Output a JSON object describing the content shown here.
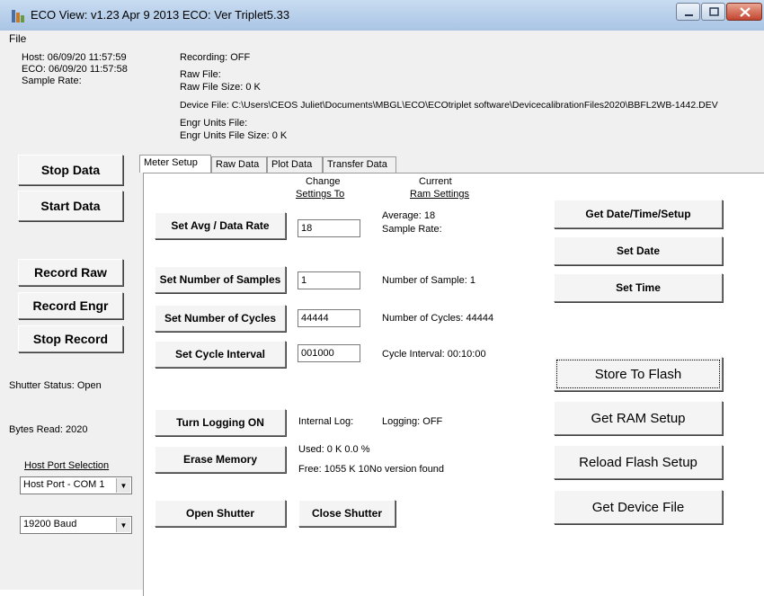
{
  "window": {
    "title": "ECO View:  v1.23 Apr  9 2013 ECO: Ver Triplet5.33"
  },
  "menu": {
    "file": "File"
  },
  "status": {
    "host": "Host:  06/09/20 11:57:59",
    "eco": "ECO:  06/09/20 11:57:58",
    "sample_rate": "Sample Rate:",
    "recording": "Recording:  OFF",
    "raw_file": "Raw File:",
    "raw_file_size": "Raw File Size:  0 K",
    "device_file": "Device File:  C:\\Users\\CEOS Juliet\\Documents\\MBGL\\ECO\\ECOtriplet software\\DevicecalibrationFiles2020\\BBFL2WB-1442.DEV",
    "engr_units_file": "Engr Units File:",
    "engr_units_file_size": "Engr Units File Size:  0 K"
  },
  "left": {
    "stop_data": "Stop Data",
    "start_data": "Start Data",
    "record_raw": "Record  Raw",
    "record_engr": "Record Engr",
    "stop_record": "Stop Record",
    "shutter_status": "Shutter Status: Open",
    "bytes_read": "Bytes Read: 2020",
    "host_port_selection": "Host Port Selection",
    "port_value": "Host Port - COM 1",
    "baud_value": "19200 Baud"
  },
  "tabs": [
    "Meter Setup",
    "Raw Data",
    "Plot Data",
    "Transfer Data"
  ],
  "meter": {
    "col_change_1": "Change",
    "col_change_2": "Settings To",
    "col_current_1": "Current",
    "col_current_2": "Ram Settings",
    "set_avg_btn": "Set Avg / Data Rate",
    "avg_value": "18",
    "avg_current": "Average: 18",
    "sample_rate_current": "Sample Rate:",
    "set_samples_btn": "Set Number of Samples",
    "samples_value": "1",
    "samples_current": "Number of Sample: 1",
    "set_cycles_btn": "Set Number of Cycles",
    "cycles_value": "44444",
    "cycles_current": "Number of Cycles: 44444",
    "set_interval_btn": "Set Cycle Interval",
    "interval_value": "001000",
    "interval_current": "Cycle Interval: 00:10:00",
    "turn_logging_btn": "Turn Logging ON",
    "internal_log": "Internal Log:",
    "logging": "Logging:  OFF",
    "erase_btn": "Erase Memory",
    "used": "Used:  0 K   0.0 %",
    "free": "Free:  1055 K  10No version found",
    "open_shutter_btn": "Open Shutter",
    "close_shutter_btn": "Close Shutter",
    "get_datetime_btn": "Get Date/Time/Setup",
    "set_date_btn": "Set Date",
    "set_time_btn": "Set Time",
    "store_flash_btn": "Store To Flash",
    "get_ram_btn": "Get RAM Setup",
    "reload_flash_btn": "Reload Flash Setup",
    "get_device_btn": "Get Device File"
  },
  "colors": {
    "titlebar": "#b8cfea",
    "window_bg": "#f0f0f0",
    "panel_bg": "#ffffff",
    "close_button": "#c6472f"
  },
  "icons": [
    "app-icon",
    "minimize-icon",
    "maximize-icon",
    "close-icon",
    "dropdown-arrow-icon"
  ]
}
